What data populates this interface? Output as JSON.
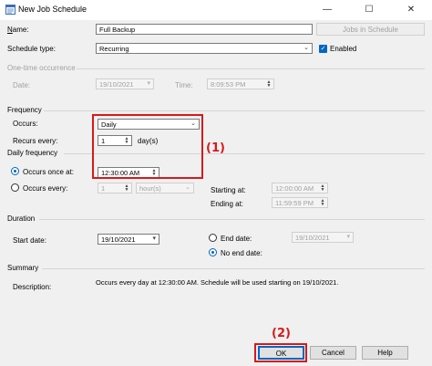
{
  "window": {
    "title": "New Job Schedule",
    "controls": {
      "minimize": "—",
      "maximize": "☐",
      "close": "✕"
    }
  },
  "name": {
    "label": "Name:",
    "value": "Full Backup"
  },
  "jobs_in_schedule": {
    "label": "Jobs in Schedule"
  },
  "schedule_type": {
    "label": "Schedule type:",
    "value": "Recurring"
  },
  "enabled": {
    "label": "Enabled",
    "checked": true
  },
  "one_time": {
    "section": "One-time occurrence",
    "date_label": "Date:",
    "date_value": "19/10/2021",
    "time_label": "Time:",
    "time_value": "8:09:53 PM"
  },
  "frequency": {
    "section": "Frequency",
    "occurs_label": "Occurs:",
    "occurs_value": "Daily",
    "recurs_label": "Recurs every:",
    "recurs_value": "1",
    "recurs_unit": "day(s)"
  },
  "daily_frequency": {
    "section": "Daily frequency",
    "once_label": "Occurs once at:",
    "once_value": "12:30:00 AM",
    "once_selected": true,
    "every_label": "Occurs every:",
    "every_value": "1",
    "every_unit": "hour(s)",
    "starting_label": "Starting at:",
    "starting_value": "12:00:00 AM",
    "ending_label": "Ending at:",
    "ending_value": "11:59:59 PM"
  },
  "duration": {
    "section": "Duration",
    "start_label": "Start date:",
    "start_value": "19/10/2021",
    "end_label": "End date:",
    "end_value": "19/10/2021",
    "no_end_label": "No end date:",
    "no_end_selected": true
  },
  "summary": {
    "section": "Summary",
    "description_label": "Description:",
    "description_value": "Occurs every day at 12:30:00 AM. Schedule will be used starting on 19/10/2021."
  },
  "buttons": {
    "ok": "OK",
    "cancel": "Cancel",
    "help": "Help"
  },
  "annotations": {
    "one": "(1)",
    "two": "(2)"
  },
  "colors": {
    "accent": "#0067c0",
    "annotation": "#d7191c"
  }
}
